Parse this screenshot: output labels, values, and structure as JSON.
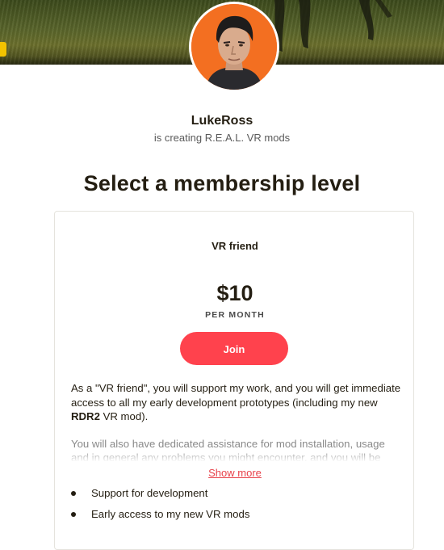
{
  "creator": {
    "name": "LukeRoss",
    "tagline": "is creating R.E.A.L. VR mods"
  },
  "heading": "Select a membership level",
  "tier": {
    "name": "VR friend",
    "price": "$10",
    "period": "PER MONTH",
    "join_label": "Join",
    "description_pre": "As a \"VR friend\", you will support my work, and you will get immediate access to all my early development prototypes (including my new ",
    "description_bold": "RDR2",
    "description_post": " VR mod).",
    "description_faded": "You will also have dedicated assistance for mod installation, usage and in general any problems you might encounter, and you will be",
    "show_more_label": "Show more",
    "benefits": [
      "Support for development",
      "Early access to my new VR mods"
    ]
  },
  "colors": {
    "accent": "#ff424d",
    "link": "#e8424a",
    "avatar_bg": "#f36f21",
    "text": "#241e12"
  }
}
